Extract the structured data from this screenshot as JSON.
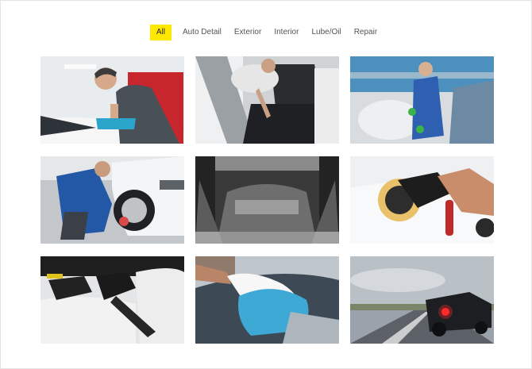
{
  "filters": [
    {
      "label": "All",
      "active": true
    },
    {
      "label": "Auto Detail",
      "active": false
    },
    {
      "label": "Exterior",
      "active": false
    },
    {
      "label": "Interior",
      "active": false
    },
    {
      "label": "Lube/Oil",
      "active": false
    },
    {
      "label": "Repair",
      "active": false
    }
  ],
  "colors": {
    "active_filter_bg": "#ffe800",
    "filter_text": "#555555",
    "frame_border": "#e4e4e4"
  },
  "gallery": [
    {
      "subject": "detailer-wiping-car"
    },
    {
      "subject": "vacuuming-car-interior"
    },
    {
      "subject": "steam-cleaning-interior"
    },
    {
      "subject": "washing-wheel"
    },
    {
      "subject": "car-wash-tunnel"
    },
    {
      "subject": "polishing-machine"
    },
    {
      "subject": "vacuuming-leather-seat"
    },
    {
      "subject": "gloved-hand-microfiber-cloth"
    },
    {
      "subject": "car-on-road"
    }
  ]
}
